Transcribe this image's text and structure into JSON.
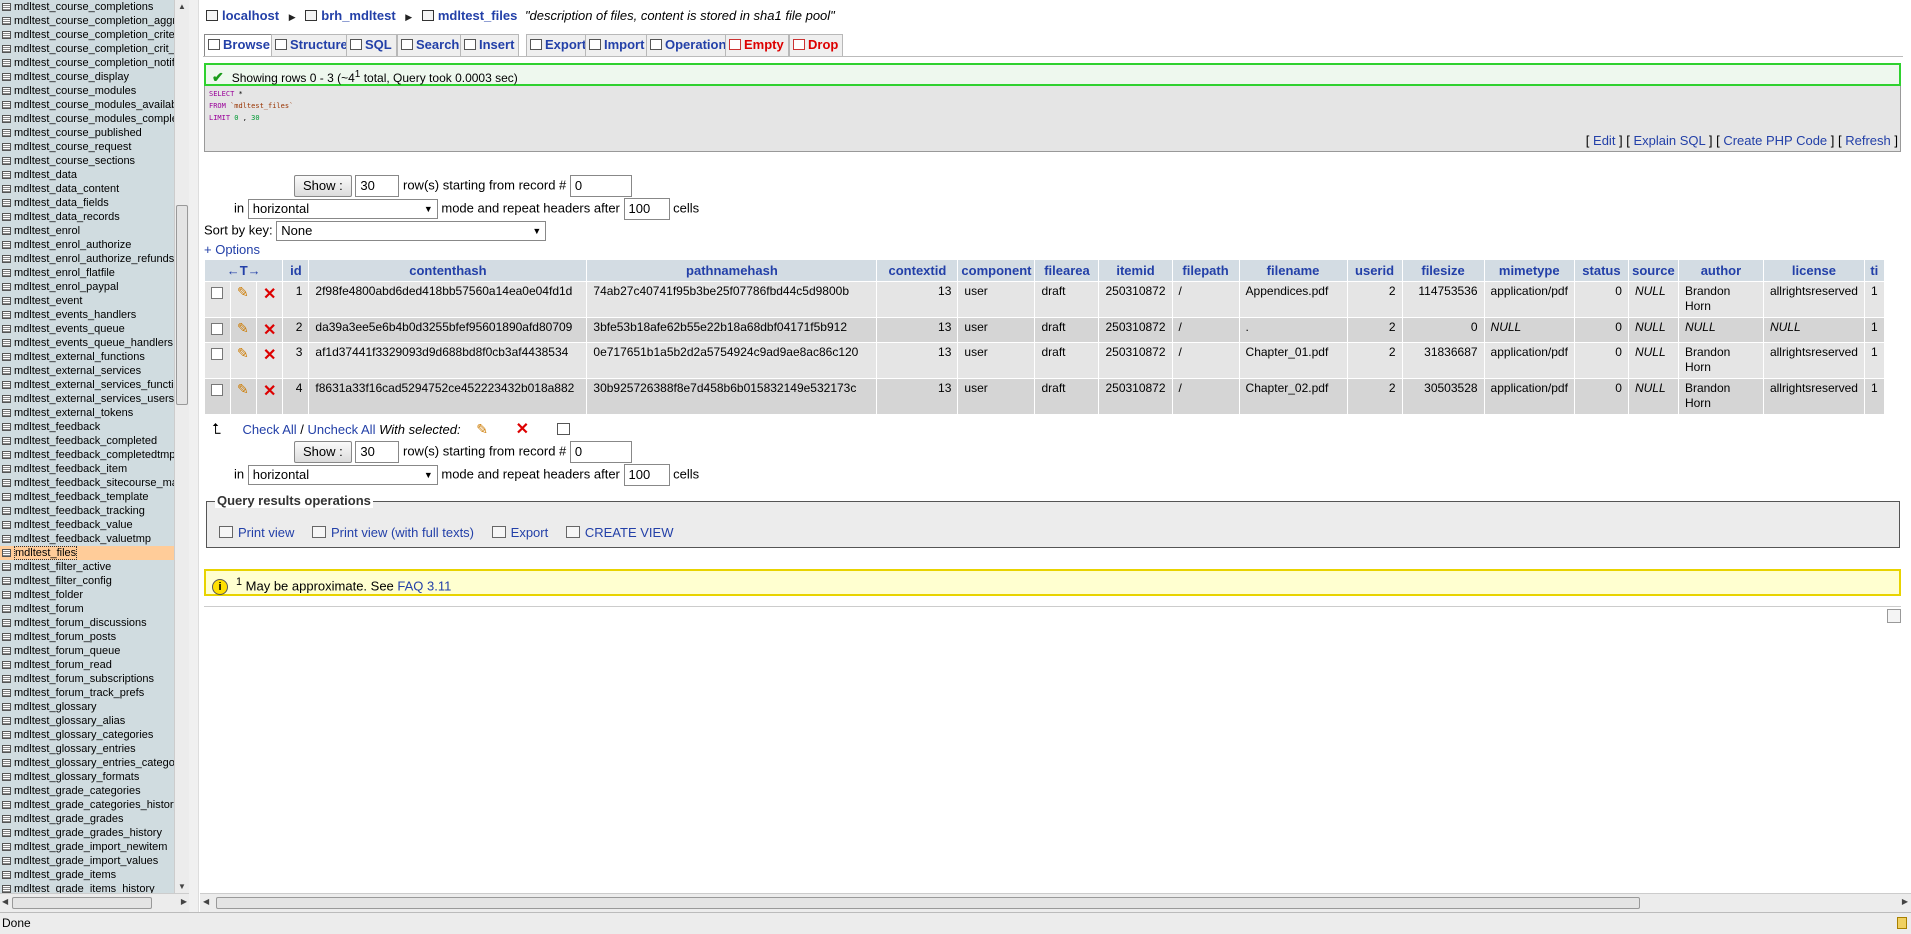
{
  "nav": {
    "tables": [
      "mdltest_course_completions",
      "mdltest_course_completion_aggr_",
      "mdltest_course_completion_crite",
      "mdltest_course_completion_crit_c",
      "mdltest_course_completion_notify",
      "mdltest_course_display",
      "mdltest_course_modules",
      "mdltest_course_modules_availab",
      "mdltest_course_modules_comple",
      "mdltest_course_published",
      "mdltest_course_request",
      "mdltest_course_sections",
      "mdltest_data",
      "mdltest_data_content",
      "mdltest_data_fields",
      "mdltest_data_records",
      "mdltest_enrol",
      "mdltest_enrol_authorize",
      "mdltest_enrol_authorize_refunds",
      "mdltest_enrol_flatfile",
      "mdltest_enrol_paypal",
      "mdltest_event",
      "mdltest_events_handlers",
      "mdltest_events_queue",
      "mdltest_events_queue_handlers",
      "mdltest_external_functions",
      "mdltest_external_services",
      "mdltest_external_services_functi",
      "mdltest_external_services_users",
      "mdltest_external_tokens",
      "mdltest_feedback",
      "mdltest_feedback_completed",
      "mdltest_feedback_completedtmp",
      "mdltest_feedback_item",
      "mdltest_feedback_sitecourse_ma",
      "mdltest_feedback_template",
      "mdltest_feedback_tracking",
      "mdltest_feedback_value",
      "mdltest_feedback_valuetmp",
      "mdltest_files",
      "mdltest_filter_active",
      "mdltest_filter_config",
      "mdltest_folder",
      "mdltest_forum",
      "mdltest_forum_discussions",
      "mdltest_forum_posts",
      "mdltest_forum_queue",
      "mdltest_forum_read",
      "mdltest_forum_subscriptions",
      "mdltest_forum_track_prefs",
      "mdltest_glossary",
      "mdltest_glossary_alias",
      "mdltest_glossary_categories",
      "mdltest_glossary_entries",
      "mdltest_glossary_entries_catego",
      "mdltest_glossary_formats",
      "mdltest_grade_categories",
      "mdltest_grade_categories_history",
      "mdltest_grade_grades",
      "mdltest_grade_grades_history",
      "mdltest_grade_import_newitem",
      "mdltest_grade_import_values",
      "mdltest_grade_items",
      "mdltest_grade_items_history"
    ],
    "active": "mdltest_files"
  },
  "breadcrumb": {
    "server": "localhost",
    "database": "brh_mdltest",
    "table": "mdltest_files",
    "comment": "\"description of files, content is stored in sha1 file pool\""
  },
  "tabs": [
    {
      "label": "Browse",
      "icon": "browse-icon"
    },
    {
      "label": "Structure",
      "icon": "structure-icon"
    },
    {
      "label": "SQL",
      "icon": "sql-icon"
    },
    {
      "label": "Search",
      "icon": "search-icon"
    },
    {
      "label": "Insert",
      "icon": "insert-icon"
    },
    {
      "label": "Export",
      "icon": "export-icon"
    },
    {
      "label": "Import",
      "icon": "import-icon"
    },
    {
      "label": "Operations",
      "icon": "operations-icon"
    },
    {
      "label": "Empty",
      "icon": "empty-icon"
    },
    {
      "label": "Drop",
      "icon": "drop-icon"
    }
  ],
  "result_message": {
    "prefix": "Showing rows 0 - 3 (~4",
    "sup": "1",
    "suffix": " total, Query took 0.0003 sec)"
  },
  "sql": {
    "line1_kw": "SELECT",
    "line1_rest": " *",
    "line2_kw": "FROM",
    "line2_tbl": " `mdltest_files`",
    "line3_kw": "LIMIT",
    "line3_num1": " 0",
    "line3_sep": " , ",
    "line3_num2": "30"
  },
  "sql_links": {
    "edit": "Edit",
    "explain": "Explain SQL",
    "php": "Create PHP Code",
    "refresh": "Refresh"
  },
  "navigation": {
    "show_label": "Show :",
    "rows": "30",
    "rows_text": "row(s) starting from record #",
    "start": "0",
    "in": "in",
    "mode": "horizontal",
    "mode_text": "mode and repeat headers after",
    "repeat": "100",
    "cells": "cells"
  },
  "sort": {
    "label": "Sort by key:",
    "value": "None"
  },
  "options_label": "+ Options",
  "table": {
    "sort_arrows": "←T→",
    "columns": [
      "id",
      "contenthash",
      "pathnamehash",
      "contextid",
      "component",
      "filearea",
      "itemid",
      "filepath",
      "filename",
      "userid",
      "filesize",
      "mimetype",
      "status",
      "source",
      "author",
      "license",
      "ti"
    ],
    "rows": [
      [
        "1",
        "2f98fe4800abd6ded418bb57560a14ea0e04fd1d",
        "74ab27c40741f95b3be25f07786fbd44c5d9800b",
        "13",
        "user",
        "draft",
        "250310872",
        "/",
        "Appendices.pdf",
        "2",
        "114753536",
        "application/pdf",
        "0",
        "NULL",
        "Brandon Horn",
        "allrightsreserved",
        "1"
      ],
      [
        "2",
        "da39a3ee5e6b4b0d3255bfef95601890afd80709",
        "3bfe53b18afe62b55e22b18a68dbf04171f5b912",
        "13",
        "user",
        "draft",
        "250310872",
        "/",
        ".",
        "2",
        "0",
        "NULL",
        "0",
        "NULL",
        "NULL",
        "NULL",
        "1"
      ],
      [
        "3",
        "af1d37441f3329093d9d688bd8f0cb3af4438534",
        "0e717651b1a5b2d2a5754924c9ad9ae8ac86c120",
        "13",
        "user",
        "draft",
        "250310872",
        "/",
        "Chapter_01.pdf",
        "2",
        "31836687",
        "application/pdf",
        "0",
        "NULL",
        "Brandon Horn",
        "allrightsreserved",
        "1"
      ],
      [
        "4",
        "f8631a33f16cad5294752ce452223432b018a882",
        "30b925726388f8e7d458b6b015832149e532173c",
        "13",
        "user",
        "draft",
        "250310872",
        "/",
        "Chapter_02.pdf",
        "2",
        "30503528",
        "application/pdf",
        "0",
        "NULL",
        "Brandon Horn",
        "allrightsreserved",
        "1"
      ]
    ]
  },
  "bulk": {
    "check_all": "Check All",
    "slash": " / ",
    "uncheck_all": "Uncheck All",
    "with_selected": "With selected:"
  },
  "qro": {
    "legend": "Query results operations",
    "print": "Print view",
    "print_full": "Print view (with full texts)",
    "export": "Export",
    "create_view": "CREATE VIEW"
  },
  "footnote": {
    "sup": "1",
    "text": " May be approximate. See ",
    "link": "FAQ 3.11"
  },
  "status_bar": "Done"
}
